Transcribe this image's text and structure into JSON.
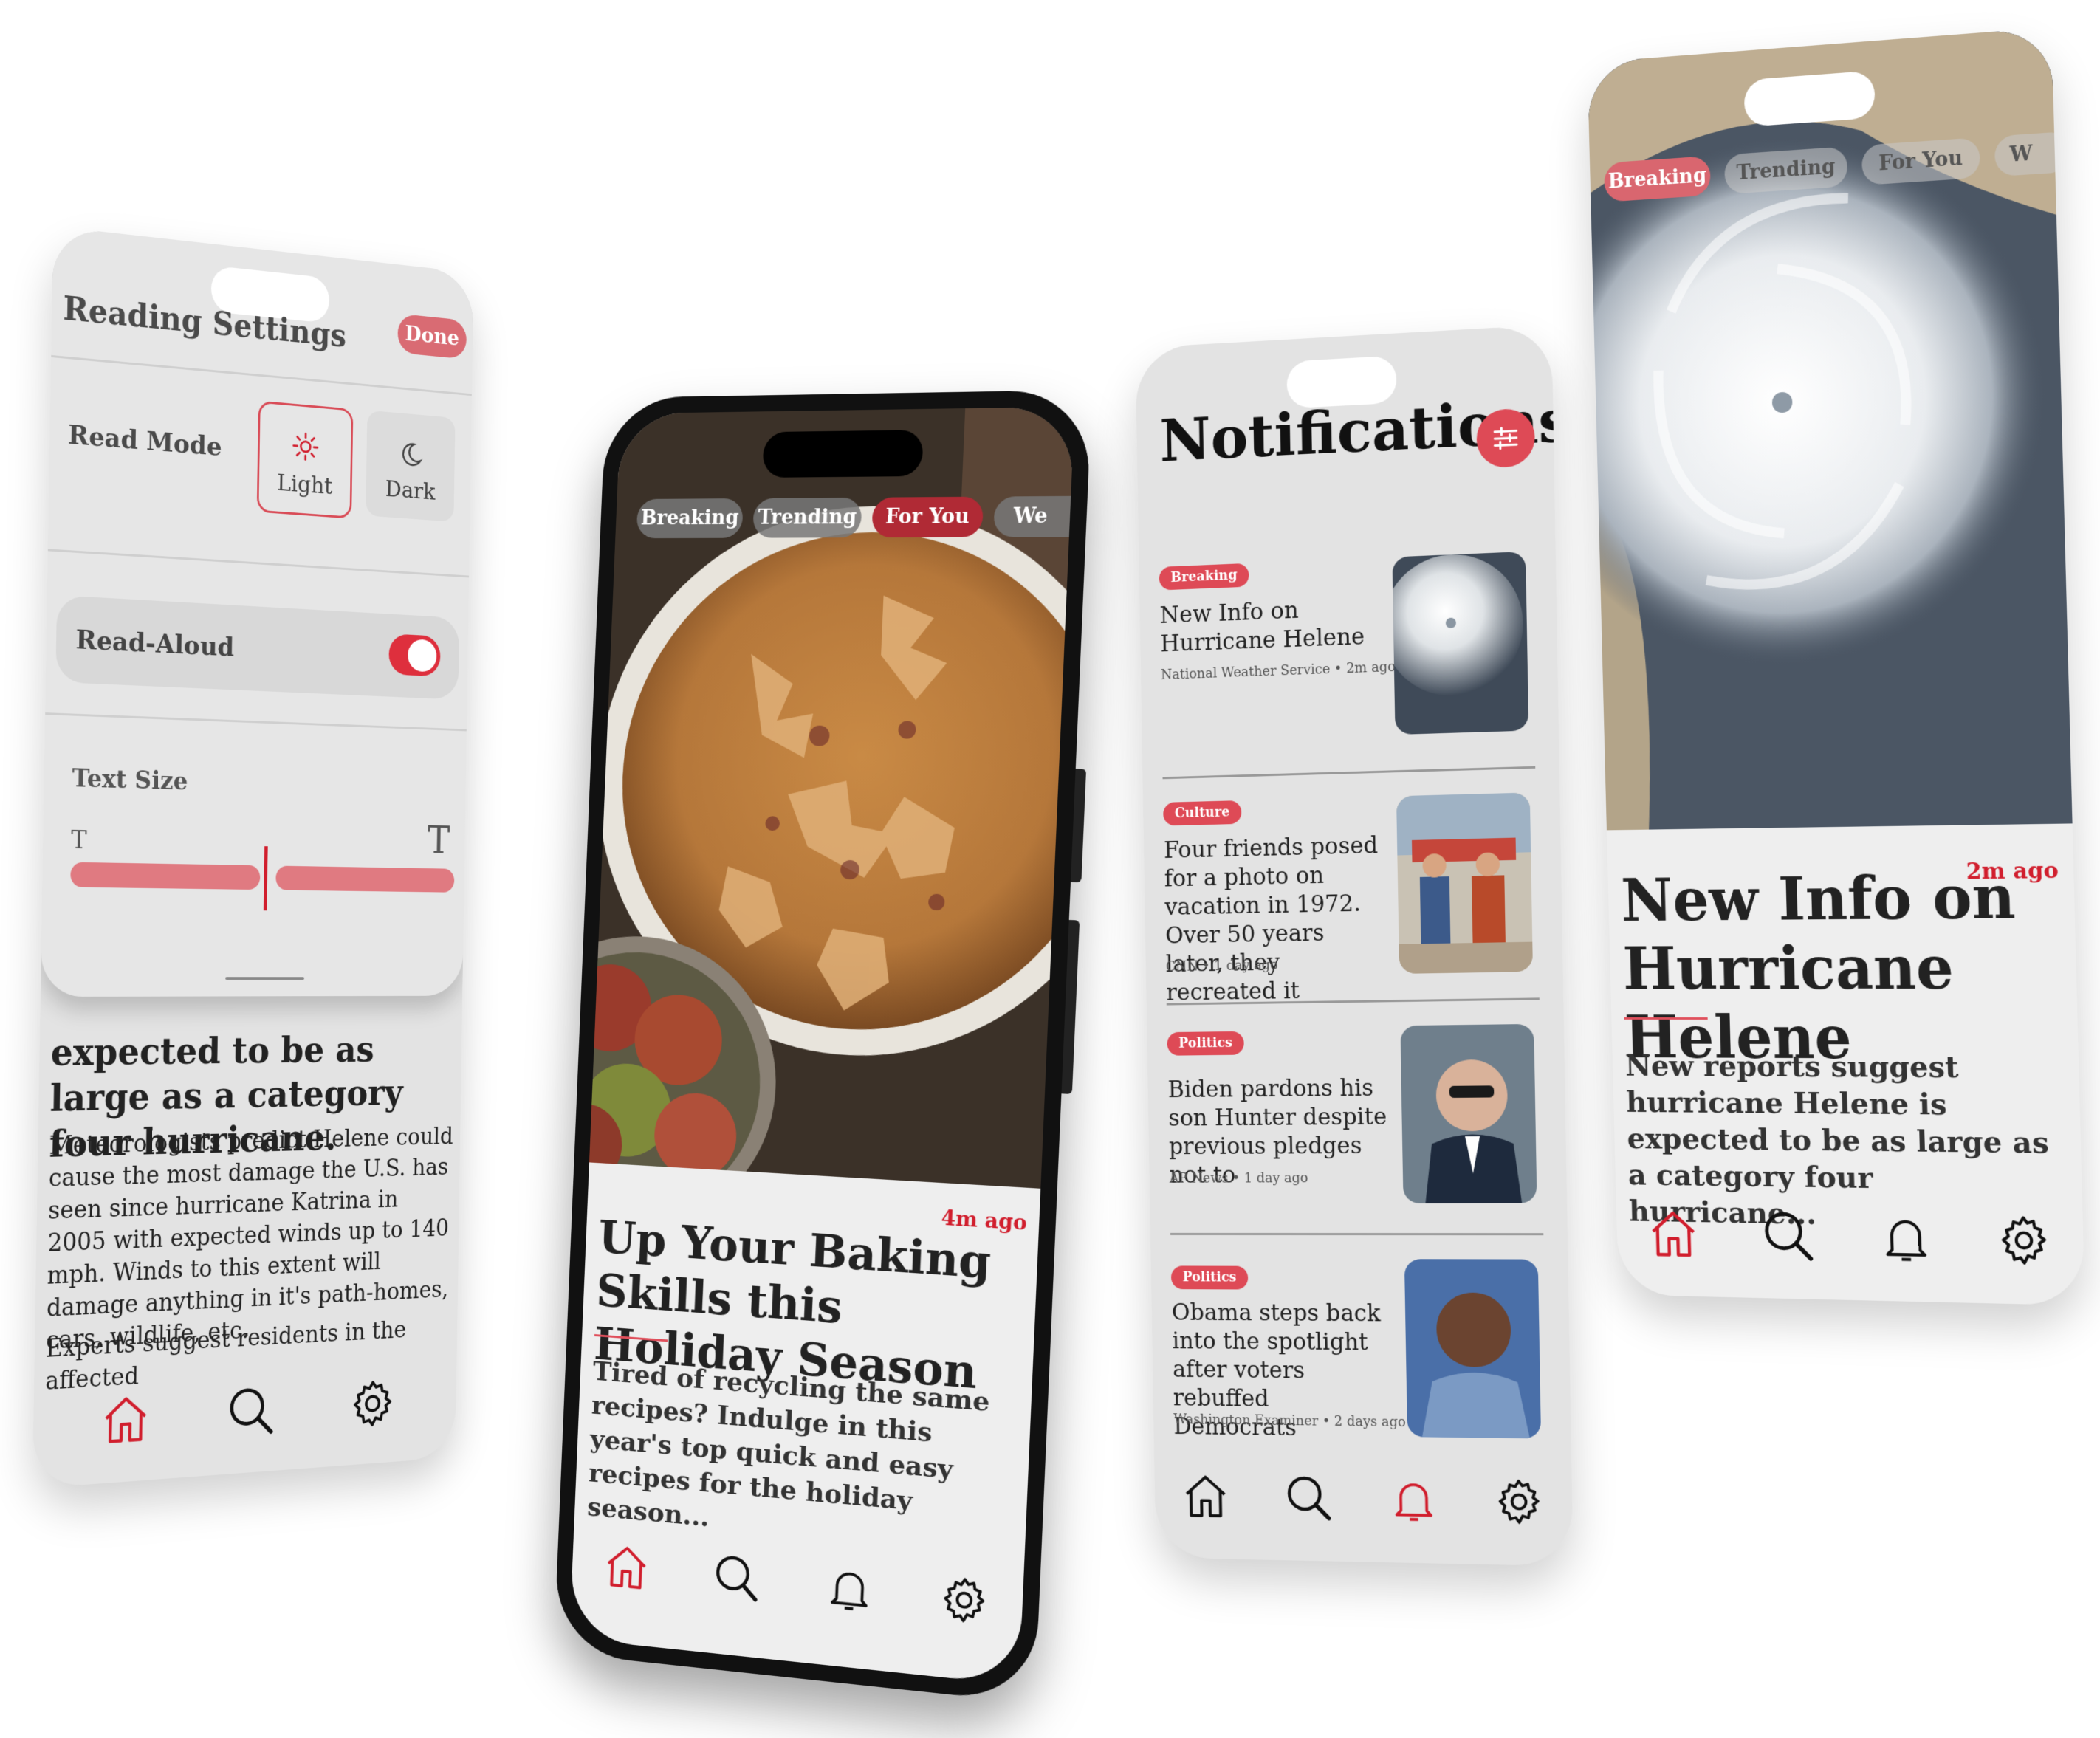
{
  "colors": {
    "accent": "#d11e2d",
    "accent_soft": "#de4a56",
    "chip_inactive": "#8a8a8a"
  },
  "settings": {
    "title": "Reading Settings",
    "done_label": "Done",
    "read_mode_label": "Read Mode",
    "light_label": "Light",
    "dark_label": "Dark",
    "selected_mode": "Light",
    "read_aloud_label": "Read-Aloud",
    "read_aloud_on": true,
    "text_size_label": "Text Size",
    "text_size_small_glyph": "T",
    "text_size_large_glyph": "T",
    "text_size_level": 0.5,
    "article_headline": "expected to be as large as a category four hurricane.",
    "article_body_1": "Meteorologists predict Helene could cause the most damage the U.S. has seen since hurricane Katrina in 2005 with expected winds up to 140 mph. Winds to this extent will damage anything in it's path-homes, cars, wildlife, etc.",
    "article_body_2": "Experts suggest residents in the affected"
  },
  "home": {
    "tabs": [
      {
        "label": "Breaking",
        "active": false
      },
      {
        "label": "Trending",
        "active": false
      },
      {
        "label": "For You",
        "active": true
      },
      {
        "label": "We",
        "active": false
      }
    ],
    "time": "4m ago",
    "headline": "Up Your Baking Skills this Holiday Season",
    "body": "Tired of recycling the same recipes? Indulge in this year's top quick and easy recipes for the holiday season..."
  },
  "notifications": {
    "title": "Notifications",
    "items": [
      {
        "tag": "Breaking",
        "headline": "New Info on Hurricane Helene",
        "source": "National Weather Service",
        "time": "2m ago"
      },
      {
        "tag": "Culture",
        "headline": "Four friends posed for a photo on vacation in 1972. Over 50 years later, they recreated it",
        "source": "CNN",
        "time": "1 day ago"
      },
      {
        "tag": "Politics",
        "headline": "Biden pardons his son Hunter despite previous pledges not to",
        "source": "AP News",
        "time": "1 day ago"
      },
      {
        "tag": "Politics",
        "headline": "Obama steps back into the spotlight after voters rebuffed Democrats",
        "source": "Washington Examiner",
        "time": "2 days ago"
      }
    ]
  },
  "article": {
    "tabs": [
      {
        "label": "Breaking",
        "active": true
      },
      {
        "label": "Trending",
        "active": false
      },
      {
        "label": "For You",
        "active": false
      },
      {
        "label": "W",
        "active": false
      }
    ],
    "time": "2m ago",
    "headline": "New Info on Hurricane Helene",
    "body": "New reports suggest hurricane Helene is expected to be as large as a category four hurricane..."
  },
  "icons": {
    "home": "home-icon",
    "search": "search-icon",
    "bell": "bell-icon",
    "settings": "gear-icon",
    "light": "sun-icon",
    "dark": "moon-icon",
    "filter": "sliders-icon"
  }
}
